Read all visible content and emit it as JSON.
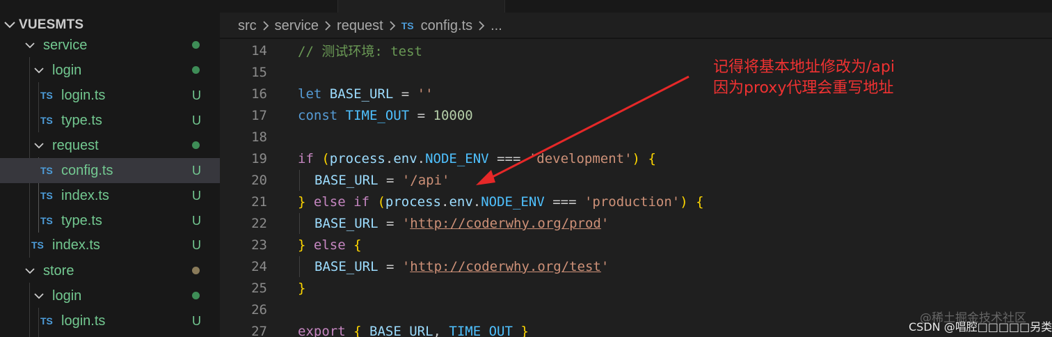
{
  "explorer": {
    "root_label": "VUESMTS",
    "items": [
      {
        "label": "service",
        "kind": "folder",
        "status": "dot"
      },
      {
        "label": "login",
        "kind": "folder",
        "status": "dot"
      },
      {
        "label": "login.ts",
        "kind": "file",
        "badge": "TS",
        "status": "U"
      },
      {
        "label": "type.ts",
        "kind": "file",
        "badge": "TS",
        "status": "U"
      },
      {
        "label": "request",
        "kind": "folder",
        "status": "dot"
      },
      {
        "label": "config.ts",
        "kind": "file",
        "badge": "TS",
        "status": "U"
      },
      {
        "label": "index.ts",
        "kind": "file",
        "badge": "TS",
        "status": "U"
      },
      {
        "label": "type.ts",
        "kind": "file",
        "badge": "TS",
        "status": "U"
      },
      {
        "label": "index.ts",
        "kind": "file",
        "badge": "TS",
        "status": "U"
      },
      {
        "label": "store",
        "kind": "folder",
        "status": "dot"
      },
      {
        "label": "login",
        "kind": "folder",
        "status": "dot"
      },
      {
        "label": "login.ts",
        "kind": "file",
        "badge": "TS",
        "status": "U"
      }
    ]
  },
  "breadcrumb": {
    "parts": [
      "src",
      "service",
      "request"
    ],
    "file_badge": "TS",
    "file": "config.ts",
    "more": "..."
  },
  "editor": {
    "line_numbers": [
      "14",
      "15",
      "16",
      "17",
      "18",
      "19",
      "20",
      "21",
      "22",
      "23",
      "24",
      "25",
      "26",
      "27"
    ],
    "comment_text": "// 测试环境: test",
    "base_url_var": "BASE_URL",
    "time_out_var": "TIME_OUT",
    "time_out_value": "10000",
    "empty_string": "''",
    "env_obj": "process",
    "env_prop": "env",
    "node_env": "NODE_ENV",
    "dev_string": "'development'",
    "api_string": "'/api'",
    "prod_string": "'production'",
    "prod_url": "http://coderwhy.org/prod",
    "test_url": "http://coderwhy.org/test"
  },
  "annotation": {
    "line1": "记得将基本地址修改为/api",
    "line2": "因为proxy代理会重写地址",
    "color": "#f03232"
  },
  "watermark": {
    "line1": "@稀土掘金技术社区",
    "line2": "CSDN @唱腔□□□□□另类:)"
  }
}
